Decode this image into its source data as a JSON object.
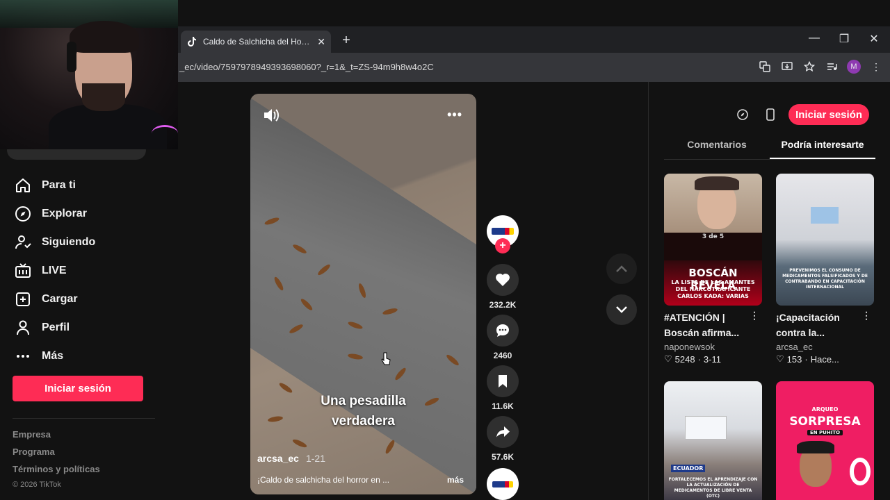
{
  "browser": {
    "tab_title": "Caldo de Salchicha del Horror en",
    "new_tab": "+",
    "url": "_ec/video/7597978949393698060?_r=1&_t=ZS-94m9h8w4o2C",
    "profile_initial": "M",
    "window_controls": [
      "—",
      "❐",
      "✕"
    ]
  },
  "sidebar": {
    "items": [
      {
        "label": "Para ti",
        "icon": "home-icon"
      },
      {
        "label": "Explorar",
        "icon": "compass-icon"
      },
      {
        "label": "Siguiendo",
        "icon": "following-icon"
      },
      {
        "label": "LIVE",
        "icon": "live-icon"
      },
      {
        "label": "Cargar",
        "icon": "upload-icon"
      },
      {
        "label": "Perfil",
        "icon": "profile-icon"
      },
      {
        "label": "Más",
        "icon": "more-icon"
      }
    ],
    "login_label": "Iniciar sesión",
    "footer": [
      "Empresa",
      "Programa",
      "Términos y políticas"
    ],
    "copyright": "© 2026 TikTok"
  },
  "video": {
    "caption_overlay_line1": "Una pesadilla",
    "caption_overlay_line2": "verdadera",
    "username": "arcsa_ec",
    "date": "1-21",
    "description": "¡Caldo de salchicha del horror en ...",
    "more": "más",
    "menu": "•••"
  },
  "actions": {
    "likes": "232.2K",
    "comments": "2460",
    "saves": "11.6K",
    "shares": "57.6K"
  },
  "right_panel": {
    "login_label": "Iniciar sesión",
    "tabs": [
      "Comentarios",
      "Podría interesarte"
    ],
    "cards": [
      {
        "title": "#ATENCIÓN | Boscán afirma...",
        "user": "naponewsok",
        "likes": "5248",
        "date": "3-11",
        "thumb_text": "BOSCÁN REVELA",
        "thumb_sub": "LA LISTA DE LAS AMANTES DEL NARCOTRAFICANTE CARLOS KADA: VARIAS",
        "badge": "3 de 5"
      },
      {
        "title": "¡Capacitación contra la...",
        "user": "arcsa_ec",
        "likes": "153",
        "date": "Hace...",
        "thumb_text": "PREVENIMOS EL CONSUMO DE MEDICAMENTOS FALSIFICADOS Y DE CONTRABANDO EN CAPACITACIÓN INTERNACIONAL"
      },
      {
        "title": "",
        "user": "",
        "likes": "",
        "date": "",
        "thumb_text": "FORTALECEMOS EL APRENDIZAJE CON LA ACTUALIZACIÓN DE MEDICAMENTOS DE LIBRE VENTA (OTC)",
        "brand": "ECUADOR"
      },
      {
        "title": "",
        "user": "",
        "likes": "",
        "date": "",
        "thumb_small": "ARQUEO",
        "thumb_text": "SORPRESA",
        "thumb_sub": "EN PUHITO"
      }
    ]
  },
  "colors": {
    "accent": "#fe2c55",
    "background": "#121212",
    "browser_chrome": "#202124"
  }
}
